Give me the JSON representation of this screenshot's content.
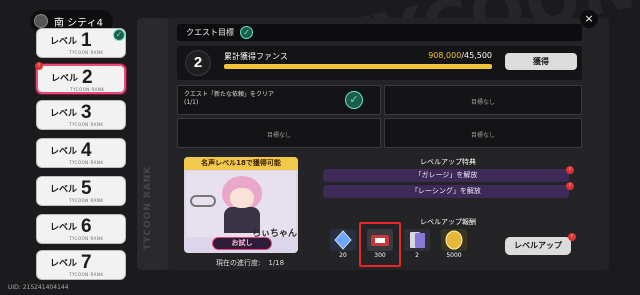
{
  "city_tab": {
    "name": "南 シティ4"
  },
  "levels": [
    {
      "label": "レベル",
      "number": "1",
      "sub": "TYCOON RANK",
      "check": "✓"
    },
    {
      "label": "レベル",
      "number": "2",
      "sub": "TYCOON RANK",
      "badge": "!"
    },
    {
      "label": "レベル",
      "number": "3",
      "sub": "TYCOON RANK"
    },
    {
      "label": "レベル",
      "number": "4",
      "sub": "TYCOON RANK"
    },
    {
      "label": "レベル",
      "number": "5",
      "sub": "TYCOON RANK"
    },
    {
      "label": "レベル",
      "number": "6",
      "sub": "TYCOON RANK"
    },
    {
      "label": "レベル",
      "number": "7",
      "sub": "TYCOON RANK"
    }
  ],
  "rail_text": "TYCOON RANK",
  "uid": "UID: 215241404144",
  "quest": {
    "header": "クエスト目標",
    "step": "2",
    "fan_label": "累計獲得ファンス",
    "fan_current": "908,000",
    "fan_target": "/45,500",
    "fan_progress": 1.0,
    "get_button": "獲得",
    "conditions": [
      {
        "text": "クエスト「新たな依頼」をクリア",
        "count": "(1/1)",
        "done": true
      },
      {
        "text": "目標なし"
      },
      {
        "text": "目標なし"
      },
      {
        "text": "目標なし"
      }
    ]
  },
  "unlock": {
    "title": "名声レベル18で獲得可能",
    "character": "ちぃちゃん",
    "trial_button": "お試し",
    "progress_label": "現在の進行度:",
    "progress_value": "1/18"
  },
  "perks": {
    "title": "レベルアップ特典",
    "items": [
      "「ガレージ」を解放",
      "「レーシング」を解放"
    ]
  },
  "rewards": {
    "title": "レベルアップ報酬",
    "items": [
      {
        "qty": "20",
        "color": "#27303f",
        "icon": "blue-crystal-icon"
      },
      {
        "qty": "300",
        "color": "#3a3a40",
        "icon": "ticket-icon"
      },
      {
        "qty": "2",
        "color": "#2f2f38",
        "icon": "card-pack-icon"
      },
      {
        "qty": "5000",
        "color": "#3a3320",
        "icon": "gold-coin-icon"
      }
    ]
  },
  "levelup_button": "レベルアップ",
  "colors": {
    "accent": "#f0c43a",
    "active_border": "#e84a78",
    "check": "#6ae3c0"
  },
  "close_icon": "×",
  "watermark": "TYCOON"
}
